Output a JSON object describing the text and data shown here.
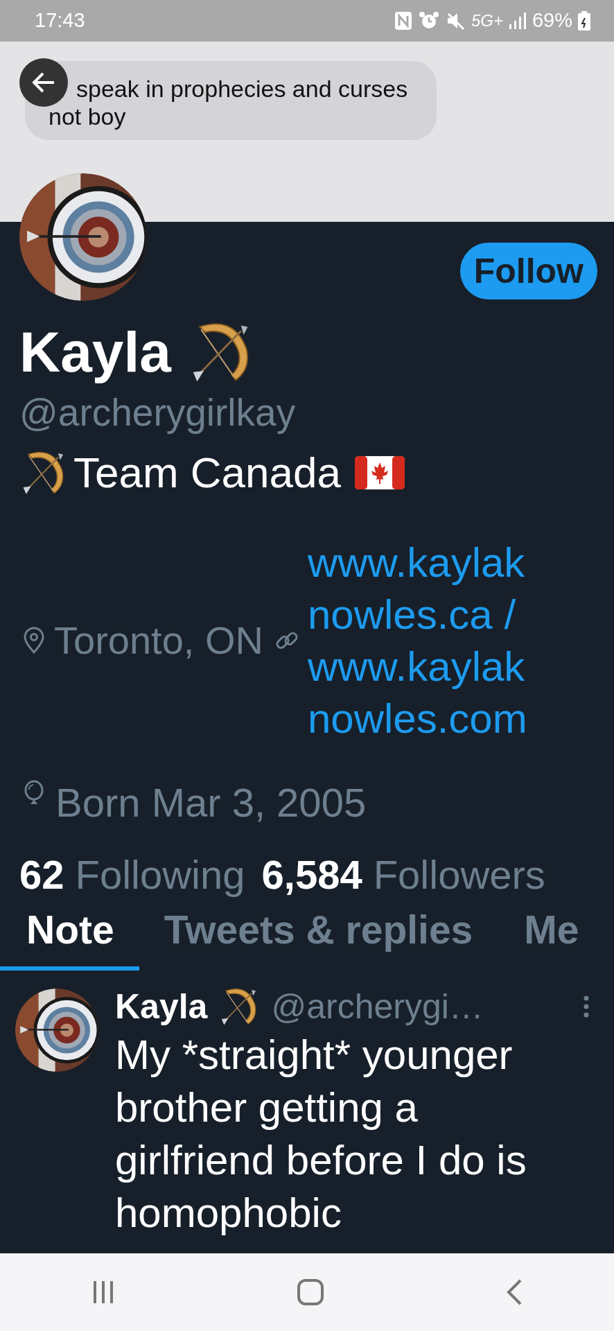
{
  "status_bar": {
    "time": "17:43",
    "network": "5G+",
    "battery": "69%"
  },
  "header": {
    "message": "speak in prophecies and curses not boy"
  },
  "profile": {
    "name": "Kayla",
    "handle": "@archerygirlkay",
    "bio": "Team Canada",
    "location": "Toronto, ON",
    "website": "www.kaylaknowles.ca / www.kaylaknowles.com",
    "birthday": "Born Mar 3, 2005",
    "follow_button": "Follow",
    "stats": [
      {
        "count": "62",
        "label": "Following"
      },
      {
        "count": "6,584",
        "label": "Followers"
      }
    ]
  },
  "tabs": [
    {
      "label": "Note",
      "selected": true
    },
    {
      "label": "Tweets & replies",
      "selected": false
    },
    {
      "label": "Me",
      "selected": false
    }
  ],
  "tweets": [
    {
      "name": "Kayla",
      "handle": "@archerygi…",
      "text": "My *straight* younger brother getting a girlfriend before I do is homophobic"
    }
  ]
}
